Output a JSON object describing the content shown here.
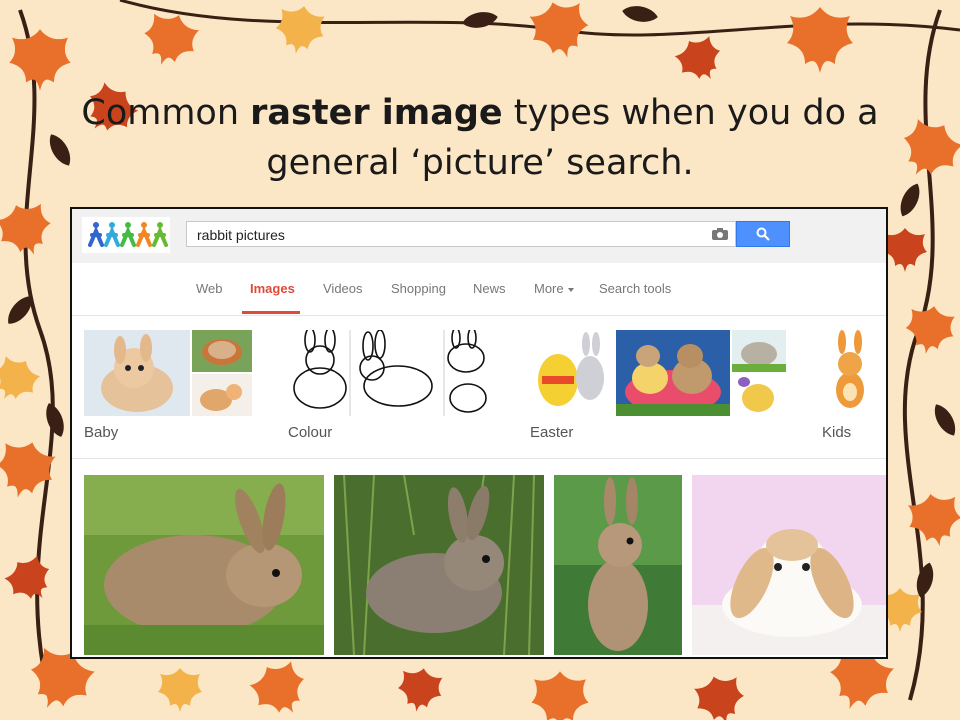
{
  "slide": {
    "title_pre": "Common ",
    "title_bold": "raster image",
    "title_post": " types when you do a general ‘picture’ search."
  },
  "search": {
    "query": "rabbit pictures",
    "camera_icon": "camera-icon",
    "search_icon": "magnifier-icon"
  },
  "tabs": [
    {
      "label": "Web",
      "active": false
    },
    {
      "label": "Images",
      "active": true
    },
    {
      "label": "Videos",
      "active": false
    },
    {
      "label": "Shopping",
      "active": false
    },
    {
      "label": "News",
      "active": false
    },
    {
      "label": "More",
      "active": false
    },
    {
      "label": "Search tools",
      "active": false
    }
  ],
  "categories": [
    {
      "label": "Baby"
    },
    {
      "label": "Colour"
    },
    {
      "label": "Easter"
    },
    {
      "label": "Kids"
    }
  ],
  "results_count_shown": 4,
  "colors": {
    "accent_red": "#dd4b39",
    "search_blue": "#4d90fe",
    "slide_bg": "#fbe7c6"
  }
}
